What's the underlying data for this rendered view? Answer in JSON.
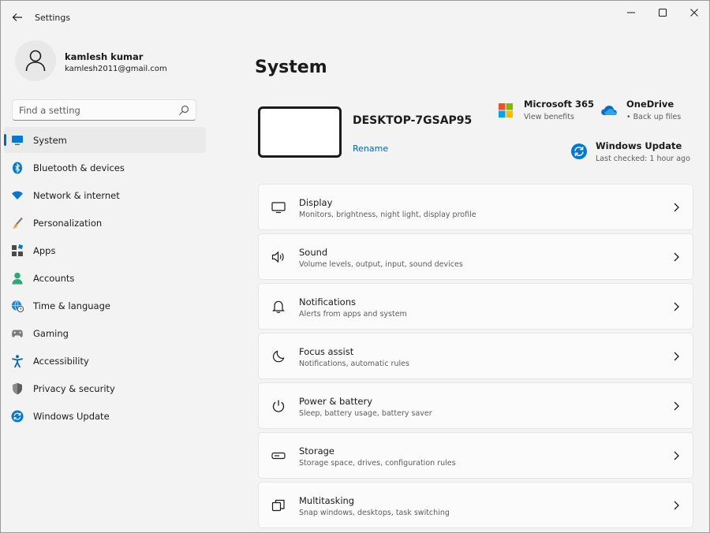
{
  "window": {
    "title": "Settings"
  },
  "user": {
    "name": "kamlesh kumar",
    "email": "kamlesh2011@gmail.com"
  },
  "search": {
    "placeholder": "Find a setting"
  },
  "sidebar": {
    "items": [
      {
        "label": "System",
        "icon": "monitor-icon",
        "selected": true
      },
      {
        "label": "Bluetooth & devices",
        "icon": "bluetooth-icon"
      },
      {
        "label": "Network & internet",
        "icon": "wifi-icon"
      },
      {
        "label": "Personalization",
        "icon": "brush-icon"
      },
      {
        "label": "Apps",
        "icon": "apps-icon"
      },
      {
        "label": "Accounts",
        "icon": "person-icon"
      },
      {
        "label": "Time & language",
        "icon": "globe-clock-icon"
      },
      {
        "label": "Gaming",
        "icon": "gamepad-icon"
      },
      {
        "label": "Accessibility",
        "icon": "accessibility-icon"
      },
      {
        "label": "Privacy & security",
        "icon": "shield-icon"
      },
      {
        "label": "Windows Update",
        "icon": "update-icon"
      }
    ]
  },
  "main": {
    "title": "System",
    "device": {
      "name": "DESKTOP-7GSAP95",
      "rename": "Rename"
    },
    "quick_links": {
      "microsoft365": {
        "title": "Microsoft 365",
        "subtitle": "View benefits"
      },
      "onedrive": {
        "title": "OneDrive",
        "subtitle": "• Back up files"
      },
      "windows_update": {
        "title": "Windows Update",
        "subtitle": "Last checked: 1 hour ago"
      }
    },
    "cards": [
      {
        "title": "Display",
        "subtitle": "Monitors, brightness, night light, display profile",
        "icon": "display-icon"
      },
      {
        "title": "Sound",
        "subtitle": "Volume levels, output, input, sound devices",
        "icon": "speaker-icon"
      },
      {
        "title": "Notifications",
        "subtitle": "Alerts from apps and system",
        "icon": "bell-icon"
      },
      {
        "title": "Focus assist",
        "subtitle": "Notifications, automatic rules",
        "icon": "moon-icon"
      },
      {
        "title": "Power & battery",
        "subtitle": "Sleep, battery usage, battery saver",
        "icon": "power-icon"
      },
      {
        "title": "Storage",
        "subtitle": "Storage space, drives, configuration rules",
        "icon": "storage-icon"
      },
      {
        "title": "Multitasking",
        "subtitle": "Snap windows, desktops, task switching",
        "icon": "multitasking-icon"
      }
    ]
  },
  "colors": {
    "accent": "#0067c0",
    "background": "#f3f3f3",
    "card": "#fbfbfb"
  }
}
